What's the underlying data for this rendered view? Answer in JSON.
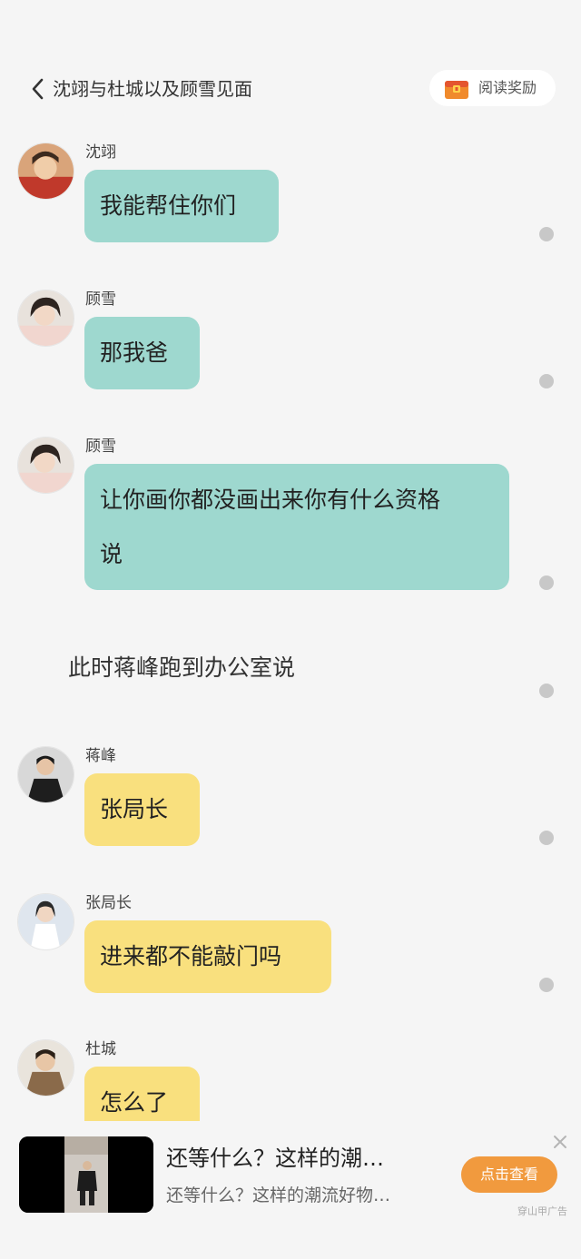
{
  "header": {
    "title": "沈翊与杜城以及顾雪见面",
    "reward_label": "阅读奖励"
  },
  "messages": [
    {
      "name": "沈翊",
      "text": "我能帮住你们",
      "color": "teal"
    },
    {
      "name": "顾雪",
      "text": "那我爸",
      "color": "teal"
    },
    {
      "name": "顾雪",
      "text_line1": "让你画你都没画出来你有什么资格",
      "text_line2": "说",
      "color": "teal"
    },
    {
      "narration": "此时蒋峰跑到办公室说"
    },
    {
      "name": "蒋峰",
      "text": "张局长",
      "color": "yellow"
    },
    {
      "name": "张局长",
      "text": "进来都不能敲门吗",
      "color": "yellow"
    },
    {
      "name": "杜城",
      "text": "怎么了",
      "color": "yellow"
    }
  ],
  "ad": {
    "title": "还等什么？这样的潮…",
    "subtitle": "还等什么？这样的潮流好物…",
    "button_label": "点击查看",
    "source": "穿山甲广告"
  },
  "colors": {
    "teal_bubble": "#9ed8cf",
    "yellow_bubble": "#f9e07e",
    "ad_button": "#f19a3e",
    "background": "#f5f5f5"
  }
}
